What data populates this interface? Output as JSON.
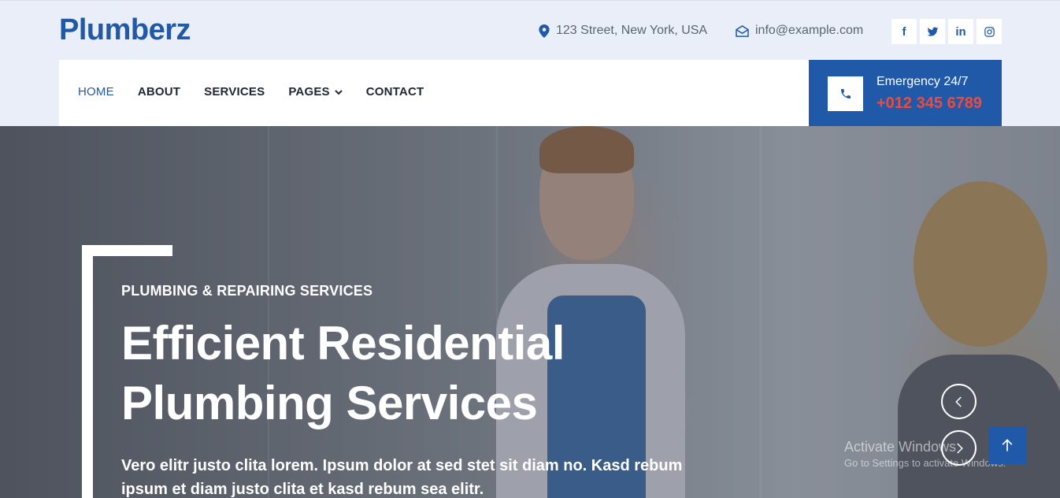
{
  "brand": {
    "name": "Plumberz"
  },
  "topbar": {
    "address": "123 Street, New York, USA",
    "email": "info@example.com",
    "socials": [
      {
        "icon": "facebook-icon",
        "glyph": "f"
      },
      {
        "icon": "twitter-icon",
        "glyph": ""
      },
      {
        "icon": "linkedin-icon",
        "glyph": "in"
      },
      {
        "icon": "instagram-icon",
        "glyph": ""
      }
    ]
  },
  "nav": {
    "items": [
      {
        "label": "HOME",
        "active": true
      },
      {
        "label": "ABOUT"
      },
      {
        "label": "SERVICES"
      },
      {
        "label": "PAGES",
        "dropdown": true
      },
      {
        "label": "CONTACT"
      }
    ]
  },
  "emergency": {
    "label": "Emergency 24/7",
    "phone": "+012 345 6789"
  },
  "hero": {
    "subtitle": "PLUMBING & REPAIRING SERVICES",
    "title_line1": "Efficient Residential",
    "title_line2": "Plumbing Services",
    "description": "Vero elitr justo clita lorem. Ipsum dolor at sed stet sit diam no. Kasd rebum ipsum et diam justo clita et kasd rebum sea elitr."
  },
  "watermark": {
    "title": "Activate Windows",
    "subtitle": "Go to Settings to activate Windows."
  },
  "colors": {
    "brand_blue": "#2059a8",
    "accent_red": "#f04a3c",
    "topbar_bg": "#e9eef8"
  }
}
